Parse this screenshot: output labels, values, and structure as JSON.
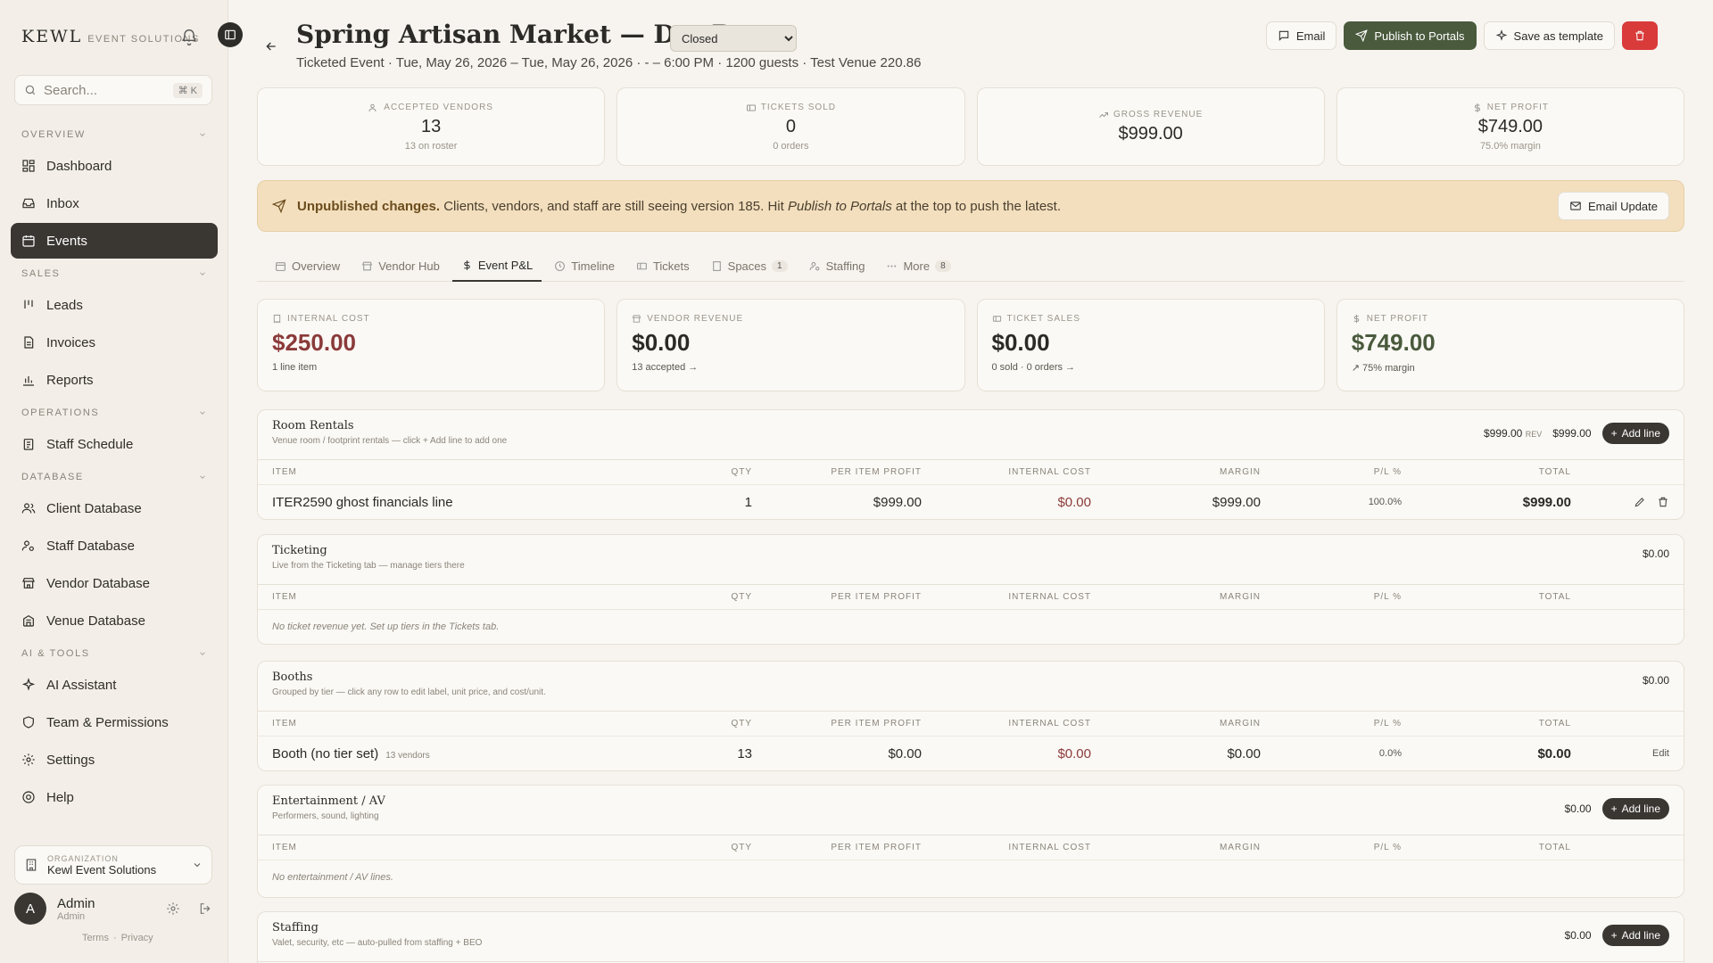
{
  "sidebar": {
    "brand": "KEWL",
    "brand_sub": "EVENT SOLUTIONS",
    "search_placeholder": "Search...",
    "search_shortcut": "⌘ K",
    "sections": [
      {
        "label": "OVERVIEW",
        "items": [
          "Dashboard",
          "Inbox",
          "Events"
        ]
      },
      {
        "label": "SALES",
        "items": [
          "Leads",
          "Invoices",
          "Reports"
        ]
      },
      {
        "label": "OPERATIONS",
        "items": [
          "Staff Schedule"
        ]
      },
      {
        "label": "DATABASE",
        "items": [
          "Client Database",
          "Staff Database",
          "Vendor Database",
          "Venue Database"
        ]
      },
      {
        "label": "AI & TOOLS",
        "items": [
          "AI Assistant",
          "Team & Permissions",
          "Settings",
          "Help"
        ]
      }
    ],
    "org_label": "ORGANIZATION",
    "org_name": "Kewl Event Solutions",
    "user_initial": "A",
    "user_name": "Admin",
    "user_role": "Admin",
    "terms": "Terms",
    "privacy": "Privacy"
  },
  "header": {
    "title": "Spring Artisan Market — Dry Run",
    "status": "Closed",
    "subtitle": "Ticketed Event · Tue, May 26, 2026 – Tue, May 26, 2026 · - – 6:00 PM · 1200 guests · Test Venue 220.86",
    "email_label": "Email",
    "publish_label": "Publish to Portals",
    "template_label": "Save as template"
  },
  "kpis": [
    {
      "label": "ACCEPTED VENDORS",
      "value": "13",
      "sub": "13 on roster"
    },
    {
      "label": "TICKETS SOLD",
      "value": "0",
      "sub": "0 orders"
    },
    {
      "label": "GROSS REVENUE",
      "value": "$999.00",
      "sub": ""
    },
    {
      "label": "NET PROFIT",
      "value": "$749.00",
      "sub": "75.0% margin"
    }
  ],
  "banner": {
    "bold": "Unpublished changes.",
    "text": "Clients, vendors, and staff are still seeing version 185. Hit",
    "italic": "Publish to Portals",
    "text2": "at the top to push the latest.",
    "button": "Email Update"
  },
  "tabs": [
    {
      "label": "Overview",
      "count": ""
    },
    {
      "label": "Vendor Hub",
      "count": ""
    },
    {
      "label": "Event P&L",
      "count": ""
    },
    {
      "label": "Timeline",
      "count": ""
    },
    {
      "label": "Tickets",
      "count": ""
    },
    {
      "label": "Spaces",
      "count": "1"
    },
    {
      "label": "Staffing",
      "count": ""
    },
    {
      "label": "More",
      "count": "8"
    }
  ],
  "fin_cards": [
    {
      "label": "INTERNAL COST",
      "value": "$250.00",
      "sub": "1 line item"
    },
    {
      "label": "VENDOR REVENUE",
      "value": "$0.00",
      "sub": "13 accepted →"
    },
    {
      "label": "TICKET SALES",
      "value": "$0.00",
      "sub": "0 sold · 0 orders →"
    },
    {
      "label": "NET PROFIT",
      "value": "$749.00",
      "sub": "↗ 75% margin"
    }
  ],
  "columns": [
    "ITEM",
    "QTY",
    "PER ITEM PROFIT",
    "INTERNAL COST",
    "MARGIN",
    "P/L %",
    "TOTAL"
  ],
  "sections": {
    "room": {
      "title": "Room Rentals",
      "desc": "Venue room / footprint rentals — click + Add line to add one",
      "rev_value": "$999.00",
      "rev_label": "REV",
      "total": "$999.00",
      "add": "Add line",
      "row": {
        "item": "ITER2590 ghost financials line",
        "qty": "1",
        "pp": "$999.00",
        "ic": "$0.00",
        "margin": "$999.00",
        "pl": "100.0%",
        "total": "$999.00"
      }
    },
    "ticketing": {
      "title": "Ticketing",
      "desc": "Live from the Ticketing tab — manage tiers there",
      "total": "$0.00",
      "empty": "No ticket revenue yet. Set up tiers in the Tickets tab."
    },
    "booths": {
      "title": "Booths",
      "desc": "Grouped by tier — click any row to edit label, unit price, and cost/unit.",
      "total": "$0.00",
      "row": {
        "item": "Booth (no tier set)",
        "vendors": "13 vendors",
        "qty": "13",
        "pp": "$0.00",
        "ic": "$0.00",
        "margin": "$0.00",
        "pl": "0.0%",
        "total": "$0.00",
        "edit": "Edit"
      }
    },
    "ent": {
      "title": "Entertainment / AV",
      "desc": "Performers, sound, lighting",
      "total": "$0.00",
      "add": "Add line",
      "empty": "No entertainment / AV lines."
    },
    "staffing": {
      "title": "Staffing",
      "desc": "Valet, security, etc — auto-pulled from staffing + BEO",
      "total": "$0.00",
      "add": "Add line"
    }
  }
}
